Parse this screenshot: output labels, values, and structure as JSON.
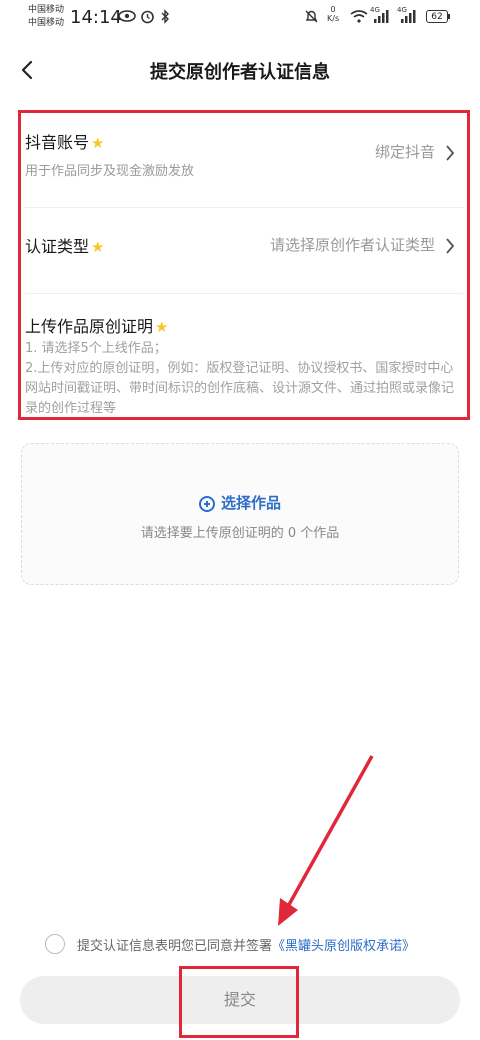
{
  "status_bar": {
    "carrier1": "中国移动",
    "carrier2": "中国移动",
    "time": "14:14",
    "net_speed_value": "0",
    "net_speed_unit": "K/s",
    "net1": "4G",
    "net2": "4G",
    "battery": "62"
  },
  "header": {
    "title": "提交原创作者认证信息"
  },
  "form": {
    "douyin": {
      "label": "抖音账号",
      "desc": "用于作品同步及现金激励发放",
      "value": "绑定抖音"
    },
    "cert_type": {
      "label": "认证类型",
      "value": "请选择原创作者认证类型"
    },
    "proof": {
      "label": "上传作品原创证明",
      "desc_line1": "1. 请选择5个上线作品；",
      "desc_line2": "2.上传对应的原创证明，例如：版权登记证明、协议授权书、国家授时中心网站时间戳证明、带时间标识的创作底稿、设计源文件、通过拍照或录像记录的创作过程等"
    }
  },
  "upload": {
    "button_label": "选择作品",
    "hint": "请选择要上传原创证明的 0 个作品"
  },
  "agreement": {
    "text": "提交认证信息表明您已同意并签署",
    "link": "《黑罐头原创版权承诺》"
  },
  "submit": {
    "label": "提交"
  },
  "colors": {
    "highlight": "#e0283a",
    "link": "#2d6ec8",
    "star": "#f3c82a"
  }
}
